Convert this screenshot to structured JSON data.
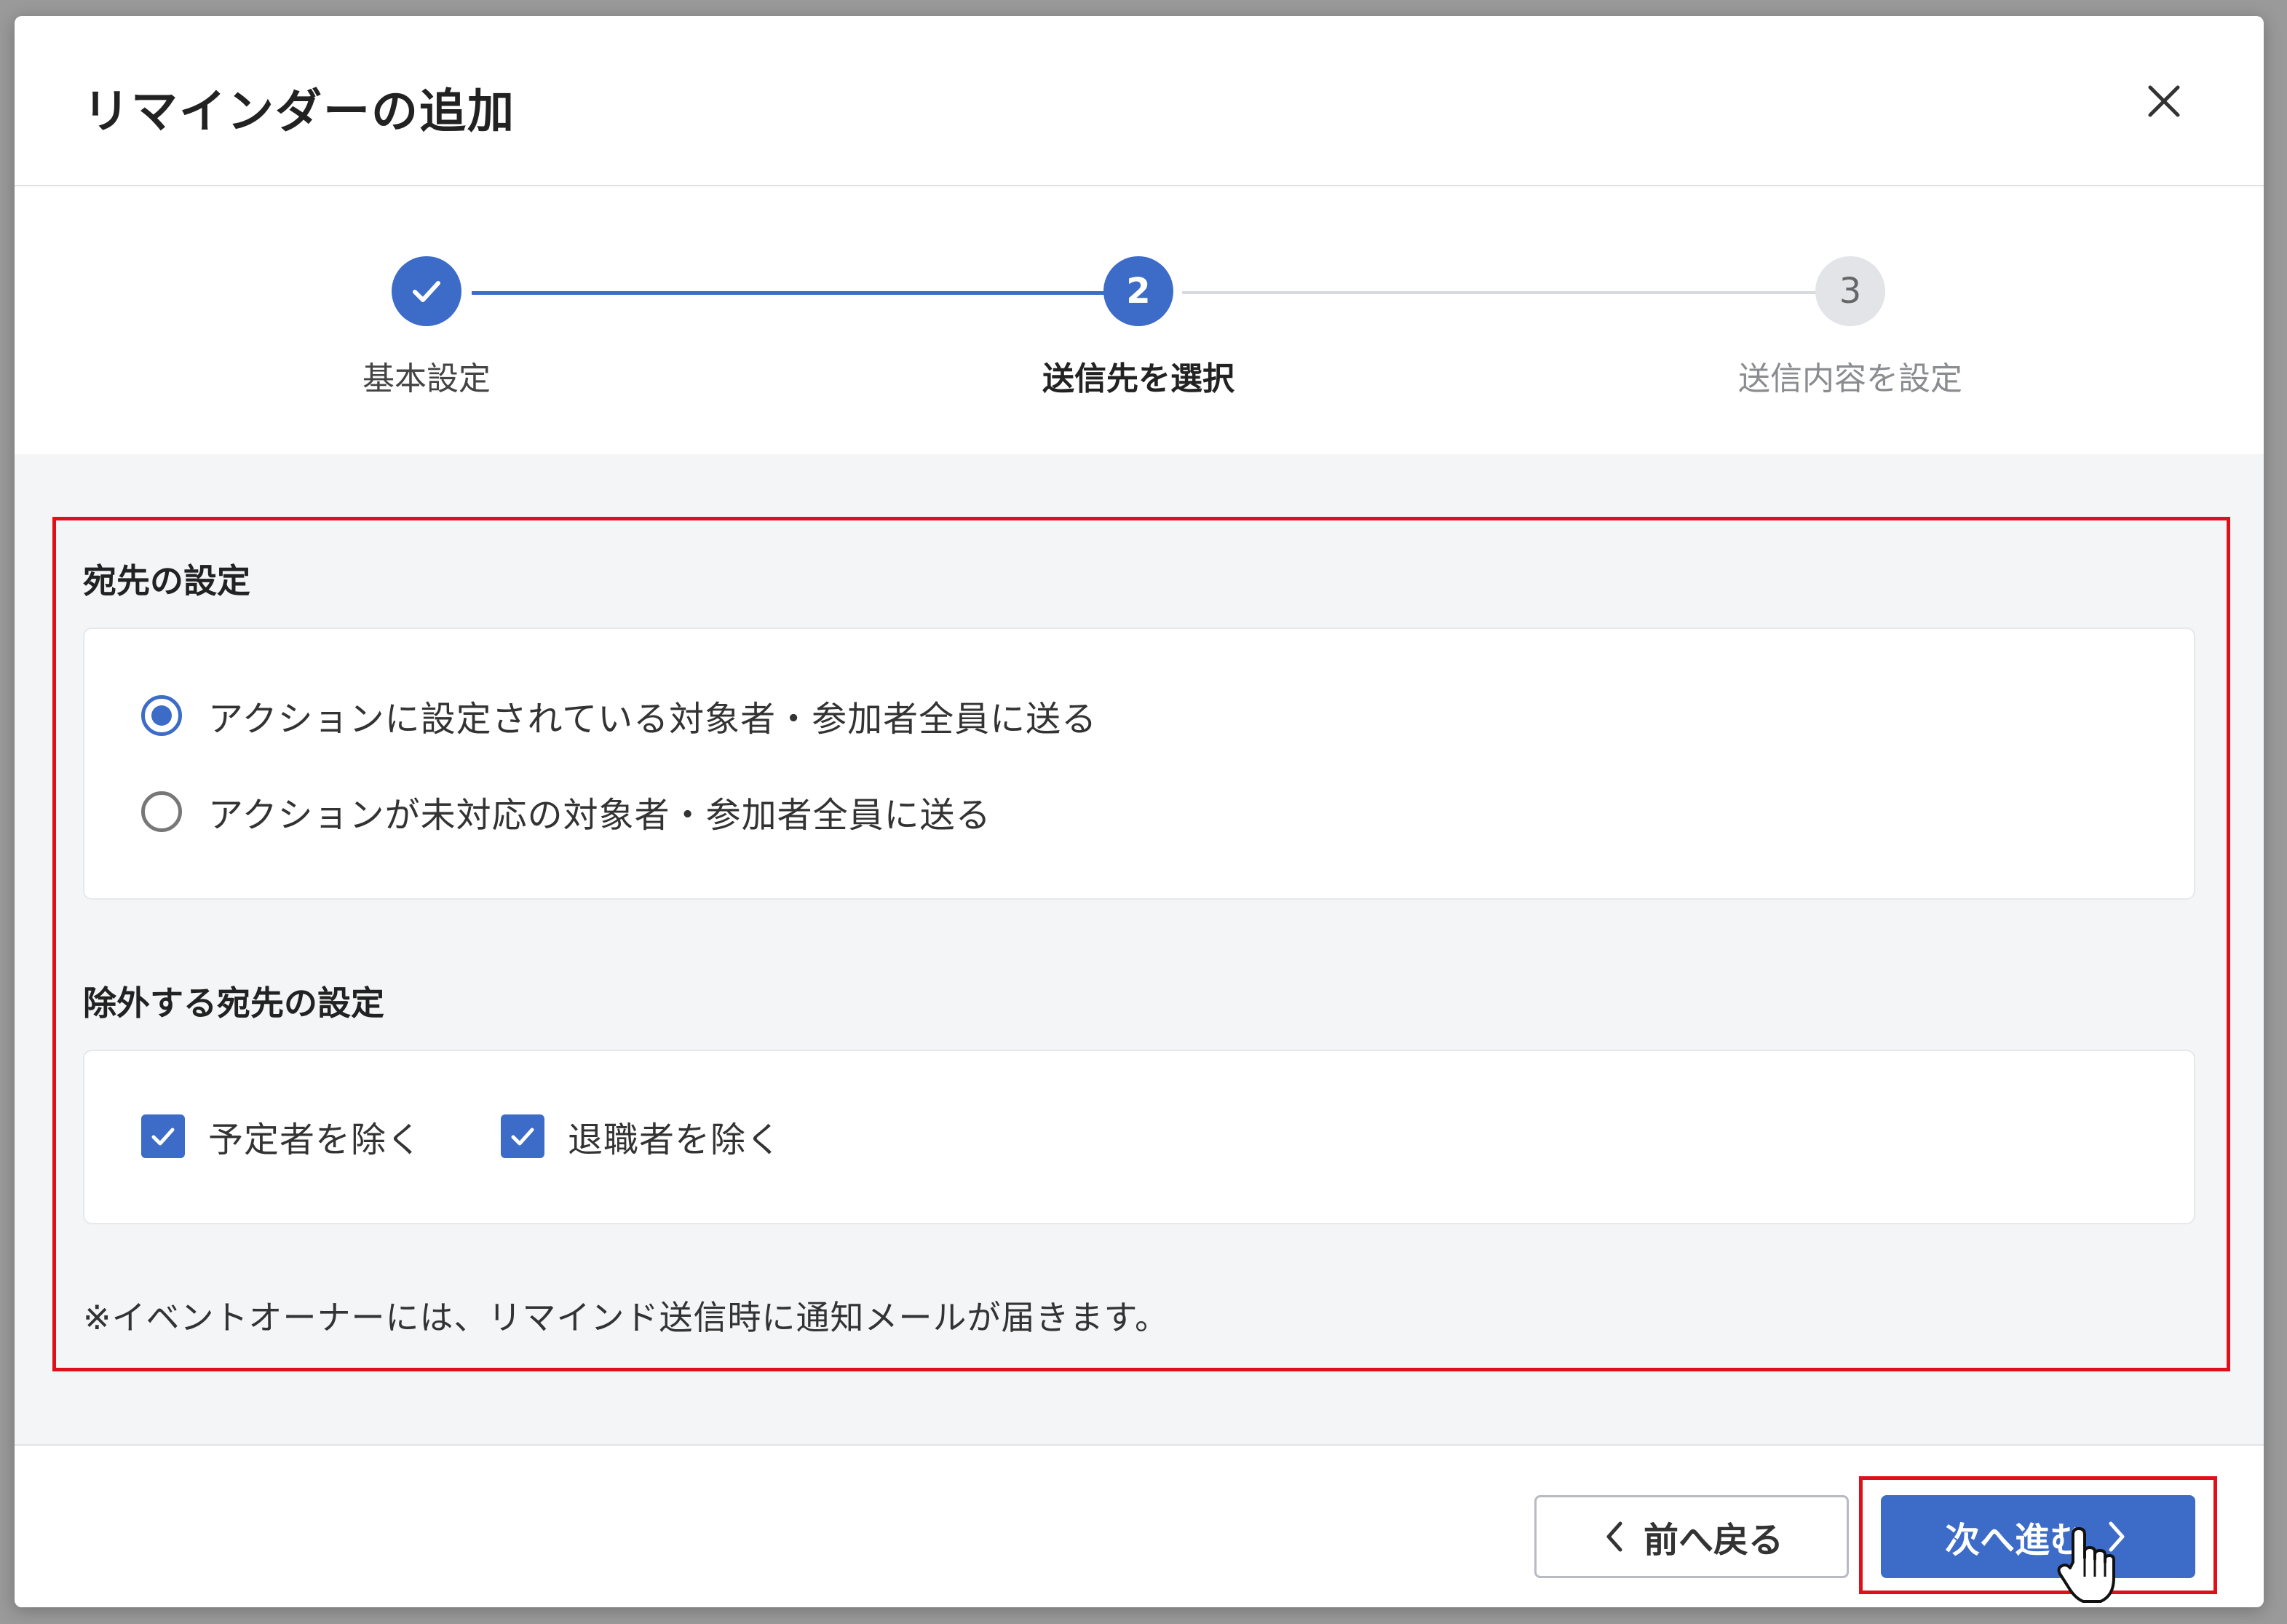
{
  "modal": {
    "title": "リマインダーの追加",
    "close_icon": "close-icon"
  },
  "stepper": {
    "steps": [
      {
        "number": "",
        "label": "基本設定",
        "state": "completed"
      },
      {
        "number": "2",
        "label": "送信先を選択",
        "state": "current"
      },
      {
        "number": "3",
        "label": "送信内容を設定",
        "state": "upcoming"
      }
    ]
  },
  "recipients": {
    "title": "宛先の設定",
    "options": [
      {
        "label": "アクションに設定されている対象者・参加者全員に送る",
        "selected": true
      },
      {
        "label": "アクションが未対応の対象者・参加者全員に送る",
        "selected": false
      }
    ]
  },
  "exclusions": {
    "title": "除外する宛先の設定",
    "options": [
      {
        "label": "予定者を除く",
        "checked": true
      },
      {
        "label": "退職者を除く",
        "checked": true
      }
    ]
  },
  "note": "※イベントオーナーには、リマインド送信時に通知メールが届きます。",
  "footer": {
    "back_label": "前へ戻る",
    "next_label": "次へ進む"
  },
  "colors": {
    "primary": "#3c6bc8",
    "highlight": "#e0101a",
    "step_inactive": "#e2e4e8"
  }
}
